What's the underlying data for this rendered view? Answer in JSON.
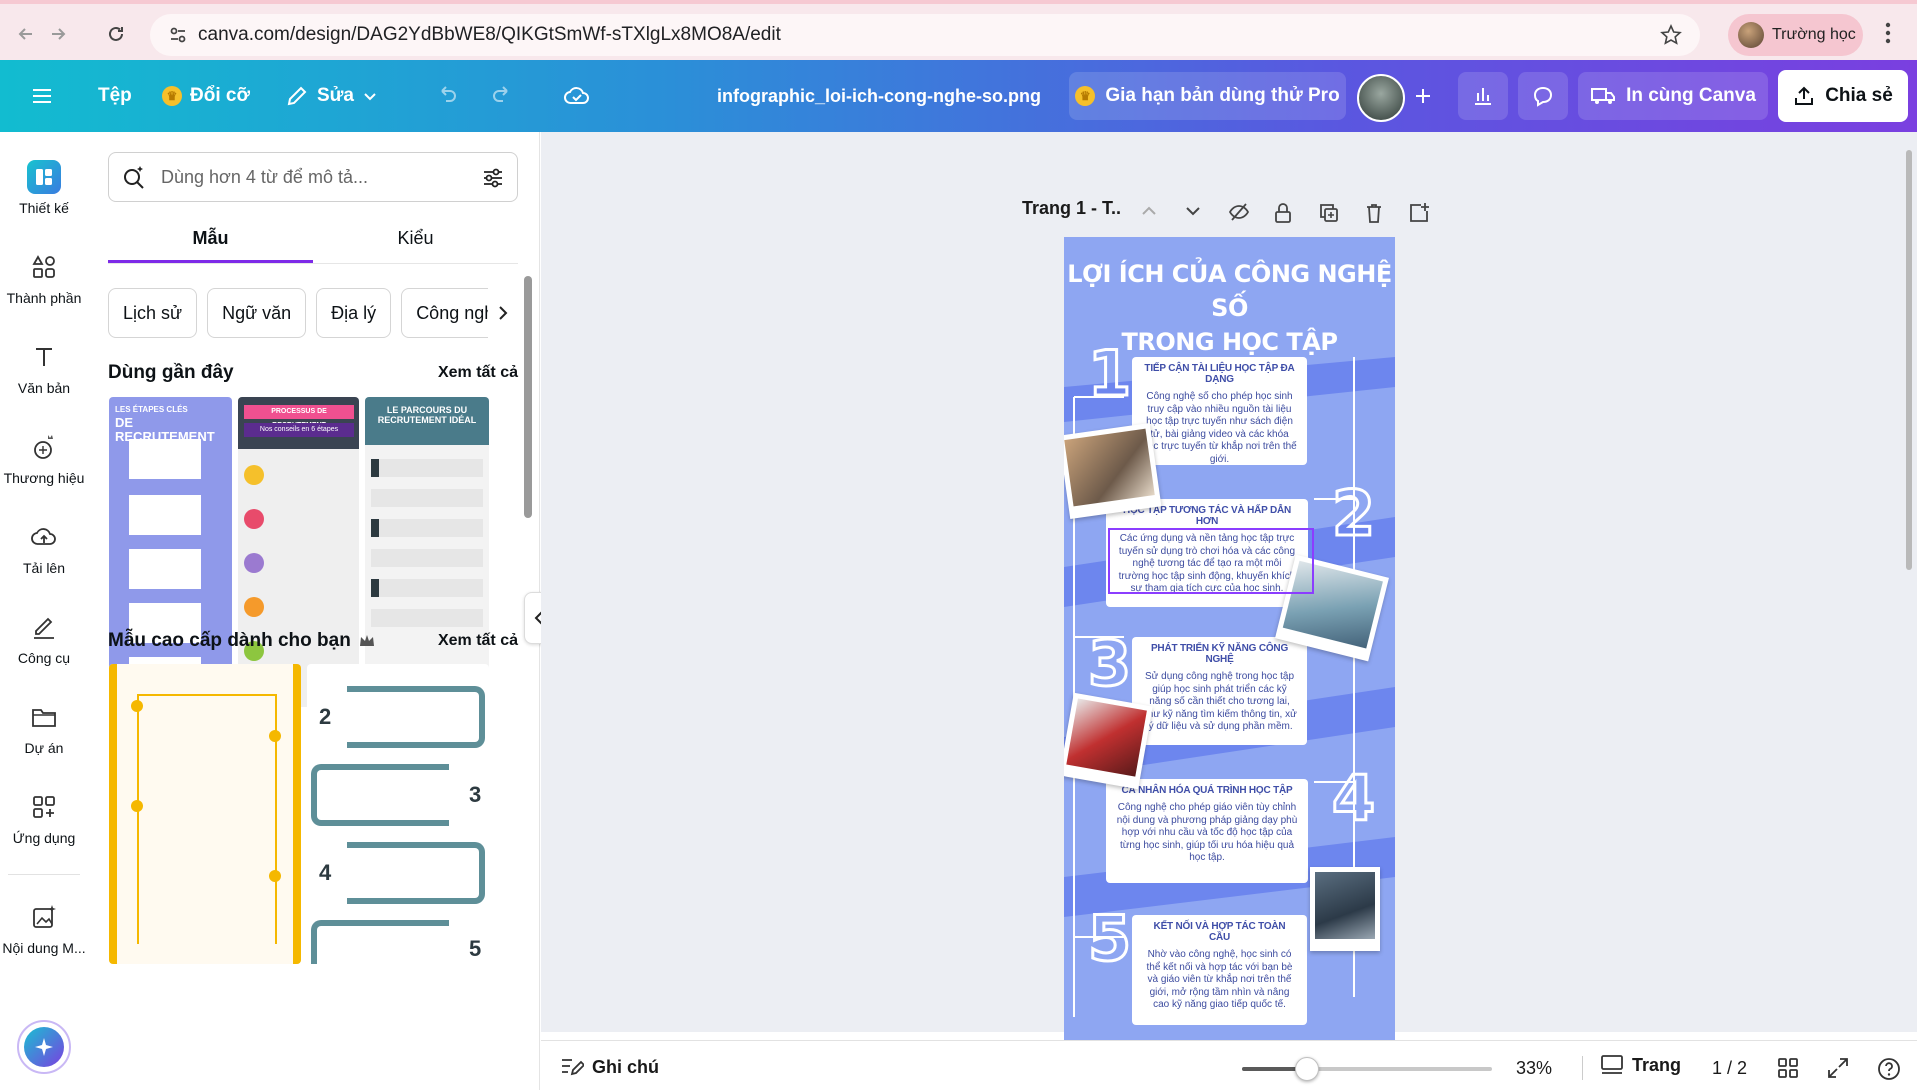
{
  "browser": {
    "url": "canva.com/design/DAG2YdBbWE8/QIKGtSmWf-sTXlgLx8MO8A/edit",
    "profile_label": "Trường học"
  },
  "header": {
    "file_label": "Tệp",
    "resize_label": "Đổi cỡ",
    "edit_label": "Sửa",
    "doc_title": "infographic_loi-ich-cong-nghe-so.png",
    "pro_label": "Gia hạn bản dùng thử Pro",
    "print_label": "In cùng Canva",
    "share_label": "Chia sẻ"
  },
  "rail": {
    "items": [
      {
        "label": "Thiết kế",
        "icon": "design-icon"
      },
      {
        "label": "Thành phần",
        "icon": "elements-icon"
      },
      {
        "label": "Văn bản",
        "icon": "text-icon"
      },
      {
        "label": "Thương hiệu",
        "icon": "brand-icon"
      },
      {
        "label": "Tải lên",
        "icon": "upload-icon"
      },
      {
        "label": "Công cụ",
        "icon": "tools-icon"
      },
      {
        "label": "Dự án",
        "icon": "folder-icon"
      },
      {
        "label": "Ứng dụng",
        "icon": "apps-icon"
      },
      {
        "label": "Nội dung M...",
        "icon": "magic-media-icon"
      }
    ]
  },
  "panel": {
    "search_placeholder": "Dùng hơn 4 từ để mô tả...",
    "tabs": [
      "Mẫu",
      "Kiểu"
    ],
    "chips": [
      "Lịch sử",
      "Ngữ văn",
      "Địa lý",
      "Công nghệ"
    ],
    "recent": {
      "title": "Dùng gần đây",
      "see_all": "Xem tất cả",
      "thumbs": [
        {
          "title_top": "LES ÉTAPES CLÉS",
          "title": "DE RECRUTEMENT"
        },
        {
          "title_top": "PROCESSUS DE RECRUTEMENT",
          "title": "Nos conseils en 6 étapes"
        },
        {
          "title_top": "LE PARCOURS DU",
          "title": "RECRUTEMENT IDÉAL"
        }
      ]
    },
    "premium": {
      "title": "Mẫu cao cấp dành cho bạn",
      "see_all": "Xem tất cả"
    }
  },
  "canvas": {
    "page_label": "Trang 1 - T..",
    "design": {
      "title_line1": "LỢI ÍCH CỦA CÔNG NGHỆ SỐ",
      "title_line2": "TRONG HỌC TẬP",
      "cards": [
        {
          "num": "1",
          "heading": "TIẾP CẬN TÀI LIỆU HỌC TẬP ĐA DẠNG",
          "body": "Công nghệ số cho phép học sinh truy cập vào nhiều nguồn tài liệu học tập trực tuyến như sách điện tử, bài giảng video và các khóa học trực tuyến từ khắp nơi trên thế giới."
        },
        {
          "num": "2",
          "heading": "HỌC TẬP TƯƠNG TÁC VÀ HẤP DẪN HƠN",
          "body": "Các ứng dụng và nền tảng học tập trực tuyến sử dụng trò chơi hóa và các công nghệ tương tác để tạo ra một môi trường học tập sinh động, khuyến khích sự tham gia tích cực của học sinh."
        },
        {
          "num": "3",
          "heading": "PHÁT TRIỂN KỸ NĂNG CÔNG NGHỆ",
          "body": "Sử dụng công nghệ trong học tập giúp học sinh phát triển các kỹ năng số cần thiết cho tương lai, như kỹ năng tìm kiếm thông tin, xử lý dữ liệu và sử dụng phần mềm."
        },
        {
          "num": "4",
          "heading": "CÁ NHÂN HÓA QUÁ TRÌNH HỌC TẬP",
          "body": "Công nghệ cho phép giáo viên tùy chỉnh nội dung và phương pháp giảng dạy phù hợp với nhu cầu và tốc độ học tập của từng học sinh, giúp tối ưu hóa hiệu quả học tập."
        },
        {
          "num": "5",
          "heading": "KẾT NỐI VÀ HỢP TÁC TOÀN CẦU",
          "body": "Nhờ vào công nghệ, học sinh có thể kết nối và hợp tác với bạn bè và giáo viên từ khắp nơi trên thế giới, mở rộng tầm nhìn và nâng cao kỹ năng giao tiếp quốc tế."
        }
      ]
    }
  },
  "bottom": {
    "notes_label": "Ghi chú",
    "zoom_value": "33%",
    "zoom_fraction": 0.26,
    "pages_label": "Trang",
    "page_count": "1 / 2"
  },
  "colors": {
    "accent": "#7d2ae8",
    "design_bg": "#8ea6f2",
    "card_text": "#3c4b9f"
  }
}
